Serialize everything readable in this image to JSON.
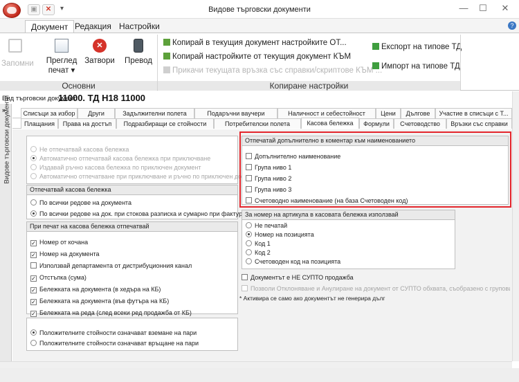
{
  "window": {
    "title": "Видове търговски документи",
    "minimize": "—",
    "maximize": "☐",
    "close": "✕"
  },
  "ribbon_tabs": [
    "Документ",
    "Редакция",
    "Настройки"
  ],
  "ribbon": {
    "save": "Запомни",
    "preview": "Преглед",
    "print": "печат ▾",
    "close": "Затвори",
    "translate": "Превод",
    "group_basic": "Основни",
    "copy_to": "Копирай в текущия документ настройките ОТ...",
    "copy_from": "Копирай настройките от текущия документ КЪМ",
    "attach_link": "Прикачи текущата връзка със справки/скриптове КЪМ ...",
    "export": "Експорт на типове ТД",
    "import": "Импорт на типове ТД",
    "group_copy": "Копиране настройки"
  },
  "doc_type": {
    "label": "Вид търговски документ:",
    "value": "11000. ТД Н18 11000"
  },
  "side_strip": {
    "arrow": "»",
    "title": "Видове търговски документи"
  },
  "tabs_row1": [
    "Списъци за избор",
    "Други",
    "Задължителни полета",
    "Подаръчни ваучери",
    "Наличност и себестойност",
    "Цени",
    "Дългове",
    "Участие в списъци с Т..."
  ],
  "tabs_row2": [
    "Плащания",
    "Права на достъп",
    "Подразбиращи се стойности",
    "Потребителски полета",
    "Касова бележка",
    "Формули",
    "Счетоводство",
    "Връзки със справки"
  ],
  "receipt_modes": [
    {
      "label": "Не отпечатвай касова бележка",
      "selected": false
    },
    {
      "label": "Автоматично отпечатвай касова бележка при приключване",
      "selected": true
    },
    {
      "label": "Издавай ръчно касова бележка по приключен документ",
      "selected": false
    },
    {
      "label": "Автоматично отпечатване при приключване и ръчно по приключен документ",
      "selected": false
    }
  ],
  "print_rows": {
    "header": "Отпечатвай касова бележка",
    "options": [
      {
        "label": "По всички редове на документа",
        "selected": false
      },
      {
        "label": "По всички редове на док. при стокова разписка и сумарно при фактура",
        "selected": true
      }
    ]
  },
  "print_fields": {
    "header": "При печат на касова бележка отпечатвай",
    "items": [
      {
        "label": "Номер от кочана",
        "checked": true
      },
      {
        "label": "Номер на документа",
        "checked": true
      },
      {
        "label": "Използвай департамента от дистрибуционния канал",
        "checked": false
      },
      {
        "label": "Отстъпка (сума)",
        "checked": true
      },
      {
        "label": "Бележката на документа (в хедъра на КБ)",
        "checked": true
      },
      {
        "label": "Бележката на документа (във футъра на КБ)",
        "checked": true
      },
      {
        "label": "Бележката на реда (след всеки ред продажба от КБ)",
        "checked": true
      }
    ]
  },
  "money_sign": [
    {
      "label": "Положителните стойности означават вземане на пари",
      "selected": true
    },
    {
      "label": "Положителните стойности означават връщане на пари",
      "selected": false
    }
  ],
  "extra_name": {
    "header": "Отпечатай допълнително в коментар към наименованието",
    "items": [
      {
        "label": "Допълнително наименование",
        "checked": false
      },
      {
        "label": "Група ниво 1",
        "checked": false
      },
      {
        "label": "Група ниво 2",
        "checked": false
      },
      {
        "label": "Група ниво 3",
        "checked": false
      },
      {
        "label": "Счетоводно наименование (на база Счетоводен код)",
        "checked": false
      }
    ]
  },
  "article_number": {
    "header": "За номер на артикула в касовата бележка използвай",
    "options": [
      {
        "label": "Не печатай",
        "selected": false
      },
      {
        "label": "Номер на позицията",
        "selected": true
      },
      {
        "label": "Код 1",
        "selected": false
      },
      {
        "label": "Код 2",
        "selected": false
      },
      {
        "label": "Счетоводен код на позицията",
        "selected": false
      }
    ]
  },
  "not_supto": "Документът е НЕ СУПТО продажба",
  "allow_cancel": "Позволи Отклоняване и Анулиране на документ от СУПТО обхвата, съобразено с груповите политики *",
  "footnote": "* Активира се само ако документът не генерира дълг"
}
